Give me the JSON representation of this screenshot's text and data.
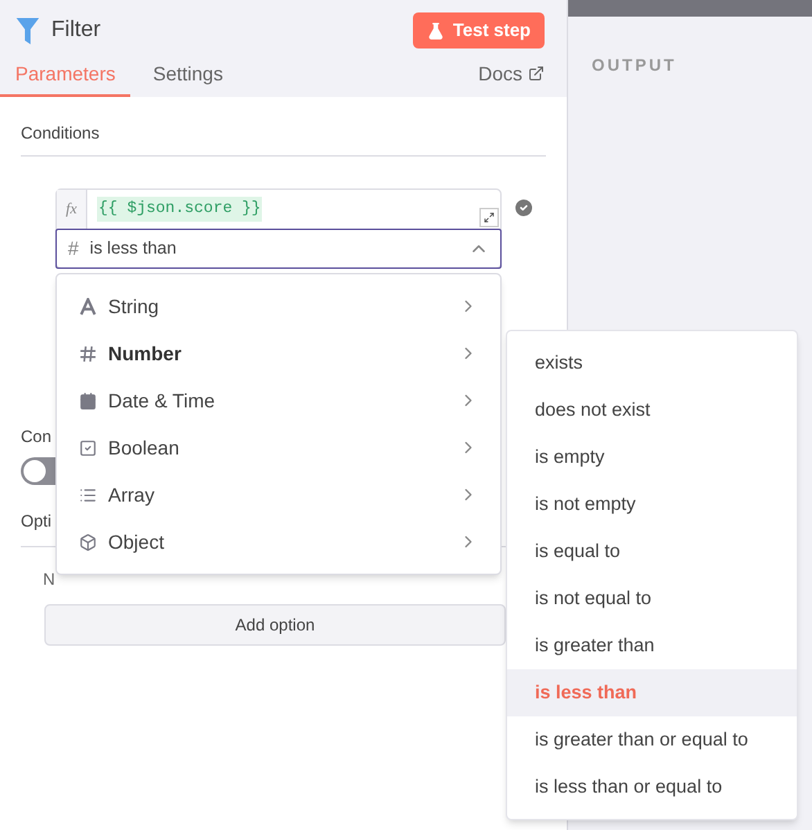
{
  "header": {
    "title": "Filter",
    "test_button": "Test step"
  },
  "tabs": [
    {
      "label": "Parameters",
      "selected": true
    },
    {
      "label": "Settings",
      "selected": false
    }
  ],
  "docs_link": "Docs",
  "output_label": "OUTPUT",
  "conditions": {
    "label": "Conditions",
    "expression_prefix": "fx",
    "expression": "{{ $json.score }}",
    "operator_icon": "#",
    "operator": "is less than"
  },
  "hidden_labels": {
    "convert_label": "Con",
    "options_label": "Opti",
    "no_options": "N"
  },
  "toggle": {
    "on": false
  },
  "add_option_button": "Add option",
  "type_menu": [
    {
      "kind": "string",
      "label": "String",
      "selected": false
    },
    {
      "kind": "number",
      "label": "Number",
      "selected": true
    },
    {
      "kind": "date",
      "label": "Date & Time",
      "selected": false
    },
    {
      "kind": "boolean",
      "label": "Boolean",
      "selected": false
    },
    {
      "kind": "array",
      "label": "Array",
      "selected": false
    },
    {
      "kind": "object",
      "label": "Object",
      "selected": false
    }
  ],
  "operator_menu": [
    {
      "label": "exists",
      "selected": false
    },
    {
      "label": "does not exist",
      "selected": false
    },
    {
      "label": "is empty",
      "selected": false
    },
    {
      "label": "is not empty",
      "selected": false
    },
    {
      "label": "is equal to",
      "selected": false
    },
    {
      "label": "is not equal to",
      "selected": false
    },
    {
      "label": "is greater than",
      "selected": false
    },
    {
      "label": "is less than",
      "selected": true
    },
    {
      "label": "is greater than or equal to",
      "selected": false
    },
    {
      "label": "is less than or equal to",
      "selected": false
    }
  ]
}
